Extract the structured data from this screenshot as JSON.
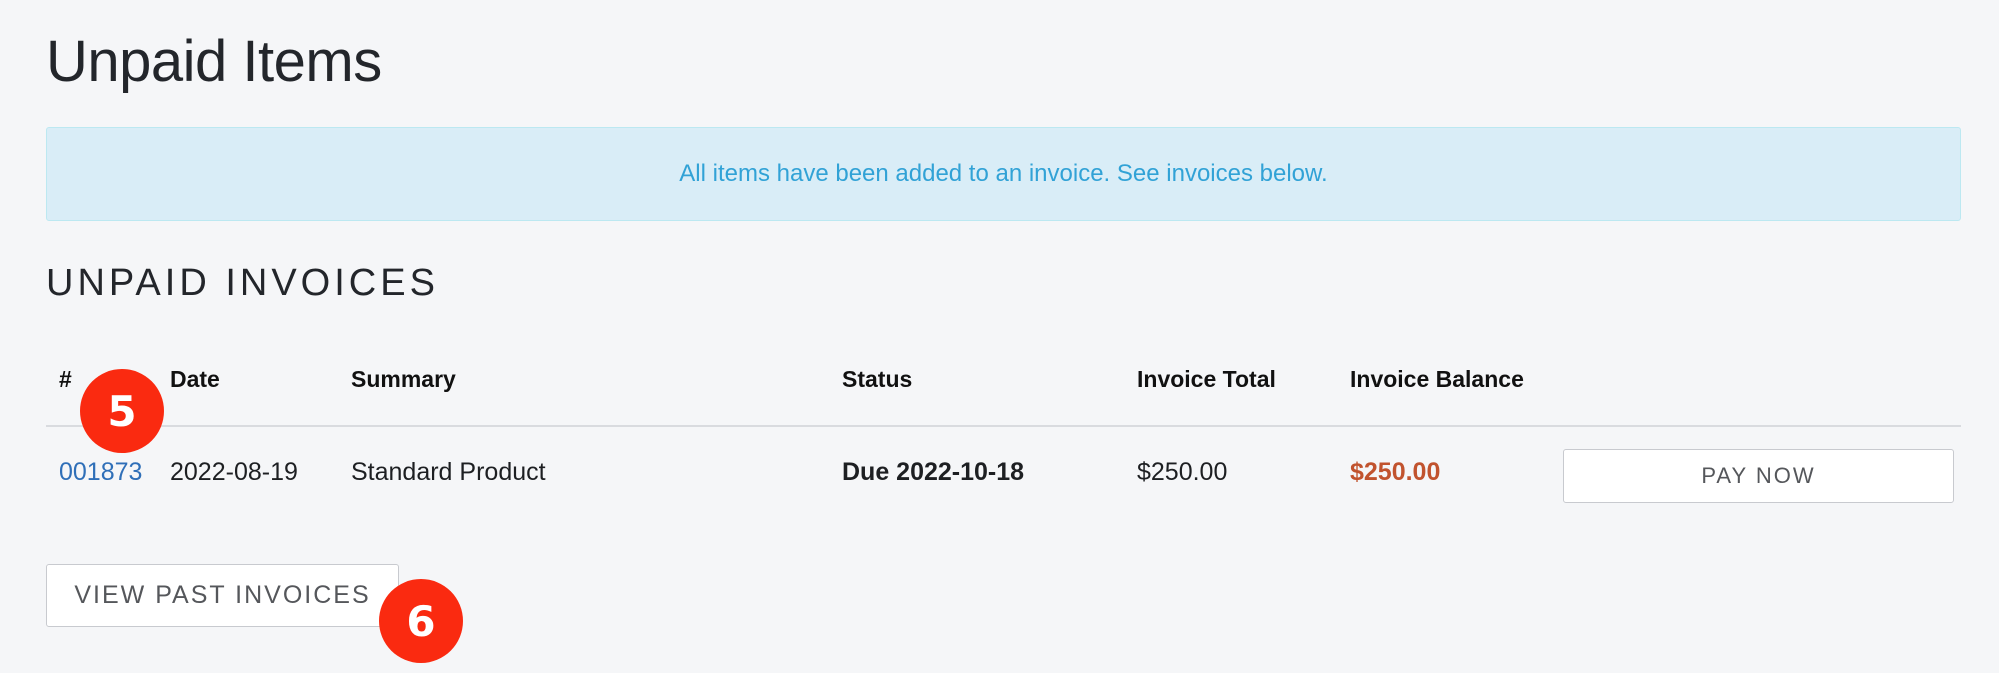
{
  "page": {
    "title": "Unpaid Items"
  },
  "alert": {
    "message": "All items have been added to an invoice. See invoices below."
  },
  "unpaid_invoices": {
    "title": "UNPAID INVOICES",
    "columns": {
      "number": "#",
      "date": "Date",
      "summary": "Summary",
      "status": "Status",
      "invoice_total": "Invoice Total",
      "invoice_balance": "Invoice Balance"
    },
    "rows": [
      {
        "number": "001873",
        "date": "2022-08-19",
        "summary": "Standard Product",
        "status": "Due 2022-10-18",
        "invoice_total": "$250.00",
        "invoice_balance": "$250.00",
        "action_label": "PAY NOW"
      }
    ]
  },
  "actions": {
    "view_past_invoices_label": "VIEW PAST INVOICES"
  },
  "badges": {
    "first": "5",
    "second": "6"
  },
  "colors": {
    "background": "#f5f6f8",
    "alert_background": "#d9edf7",
    "alert_text": "#31a2d6",
    "link": "#2f6fb8",
    "balance": "#c1532e",
    "badge": "#fa2a10"
  }
}
